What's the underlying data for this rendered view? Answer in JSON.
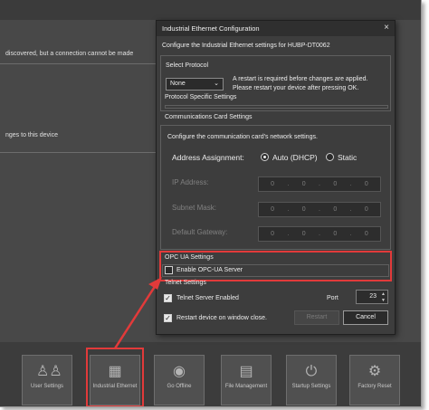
{
  "background": {
    "msg1": "discovered, but a connection cannot be made",
    "msg2": "nges to this device",
    "bottom_buttons": [
      {
        "label": "User Settings",
        "icon": "users-icon"
      },
      {
        "label": "Industrial Ethernet",
        "icon": "network-icon"
      },
      {
        "label": "Go Offline",
        "icon": "offline-icon"
      },
      {
        "label": "File Management",
        "icon": "file-icon"
      },
      {
        "label": "Startup Settings",
        "icon": "power-icon"
      },
      {
        "label": "Factory Reset",
        "icon": "reset-icon"
      }
    ]
  },
  "dialog": {
    "title": "Industrial Ethernet Configuration",
    "close": "×",
    "subtitle": "Configure the Industrial Ethernet settings for HUBP-DT0062",
    "select_protocol_label": "Select Protocol",
    "protocol_value": "None",
    "restart_note_line1": "A restart is required before changes are applied.",
    "restart_note_line2": "Please restart your device after pressing OK.",
    "protocol_specific_settings": "Protocol Specific Settings",
    "comm_card_settings": "Communications Card Settings",
    "comm_card_desc": "Configure the communication card's network settings.",
    "address_assignment_label": "Address Assignment:",
    "auto_dhcp": "Auto (DHCP)",
    "static": "Static",
    "ip_address_label": "IP Address:",
    "subnet_mask_label": "Subnet Mask:",
    "default_gateway_label": "Default Gateway:",
    "ip_address": [
      "0",
      "0",
      "0",
      "0"
    ],
    "subnet_mask": [
      "0",
      "0",
      "0",
      "0"
    ],
    "default_gateway": [
      "0",
      "0",
      "0",
      "0"
    ],
    "opc_ua_settings": "OPC UA Settings",
    "enable_opc_ua": "Enable OPC-UA Server",
    "telnet_settings": "Telnet Settings",
    "telnet_enabled": "Telnet Server Enabled",
    "port_label": "Port",
    "port_value": "23",
    "restart_on_close": "Restart device on window close.",
    "restart_button": "Restart",
    "cancel_button": "Cancel"
  },
  "colors": {
    "highlight": "#e23a3a",
    "dialog_bg": "#3d3d3d",
    "app_bg": "#484848"
  }
}
